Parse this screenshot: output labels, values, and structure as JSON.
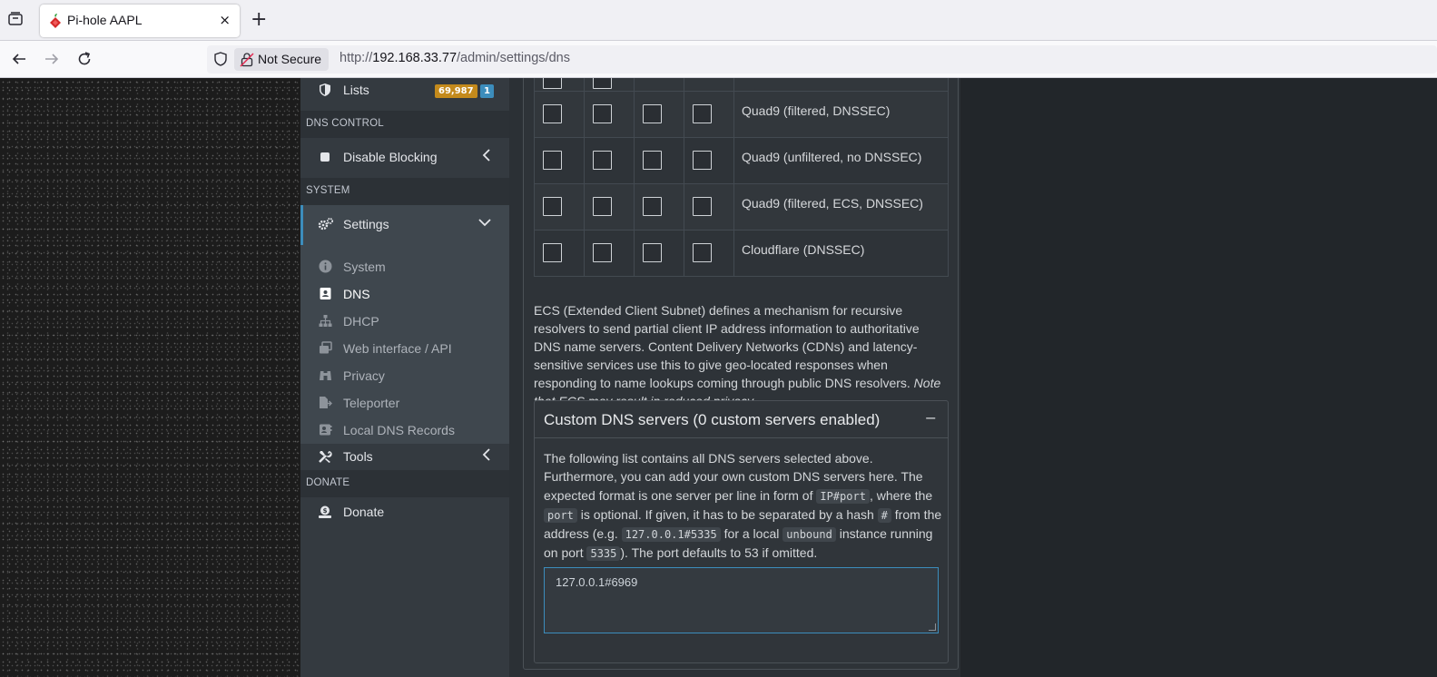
{
  "browser": {
    "tab_title": "Pi-hole AAPL",
    "tab_close": "×",
    "new_tab": "+",
    "security_label": "Not Secure",
    "url_scheme": "http://",
    "url_host": "192.168.33.77",
    "url_path": "/admin/settings/dns"
  },
  "sidebar": {
    "lists": {
      "label": "Lists",
      "badge_count": "69,987",
      "badge_groups": "1",
      "badge_count_color": "#c48a1c",
      "badge_groups_color": "#3c8dbc"
    },
    "header_dns_control": "DNS CONTROL",
    "disable_blocking": "Disable Blocking",
    "header_system": "SYSTEM",
    "settings": "Settings",
    "settings_items": [
      "System",
      "DNS",
      "DHCP",
      "Web interface / API",
      "Privacy",
      "Teleporter",
      "Local DNS Records"
    ],
    "tools": "Tools",
    "header_donate": "DONATE",
    "donate": "Donate"
  },
  "upstream_table": {
    "rows": [
      {
        "name": ""
      },
      {
        "name": "Quad9 (filtered, DNSSEC)"
      },
      {
        "name": "Quad9 (unfiltered, no DNSSEC)"
      },
      {
        "name": "Quad9 (filtered, ECS, DNSSEC)"
      },
      {
        "name": "Cloudflare (DNSSEC)"
      }
    ]
  },
  "ecs": {
    "text": "ECS (Extended Client Subnet) defines a mechanism for recursive resolvers to send partial client IP address information to authoritative DNS name servers. Content Delivery Networks (CDNs) and latency-sensitive services use this to give geo-located responses when responding to name lookups coming through public DNS resolvers. ",
    "note": "Note that ECS may result in reduced privacy."
  },
  "custom_dns": {
    "title": "Custom DNS servers (0 custom servers enabled)",
    "collapse": "−",
    "desc_1": "The following list contains all DNS servers selected above. Furthermore, you can add your own custom DNS servers here. The expected format is one server per line in form of ",
    "code_1": "IP#port",
    "desc_2": ", where the ",
    "code_2": "port",
    "desc_3": " is optional. If given, it has to be separated by a hash ",
    "code_3": "#",
    "desc_4": " from the address (e.g. ",
    "code_4": "127.0.0.1#5335",
    "desc_5": " for a local ",
    "code_5": "unbound",
    "desc_6": " instance running on port ",
    "code_6": "5335",
    "desc_7": "). The port defaults to 53 if omitted.",
    "textarea_value": "127.0.0.1#6969"
  }
}
